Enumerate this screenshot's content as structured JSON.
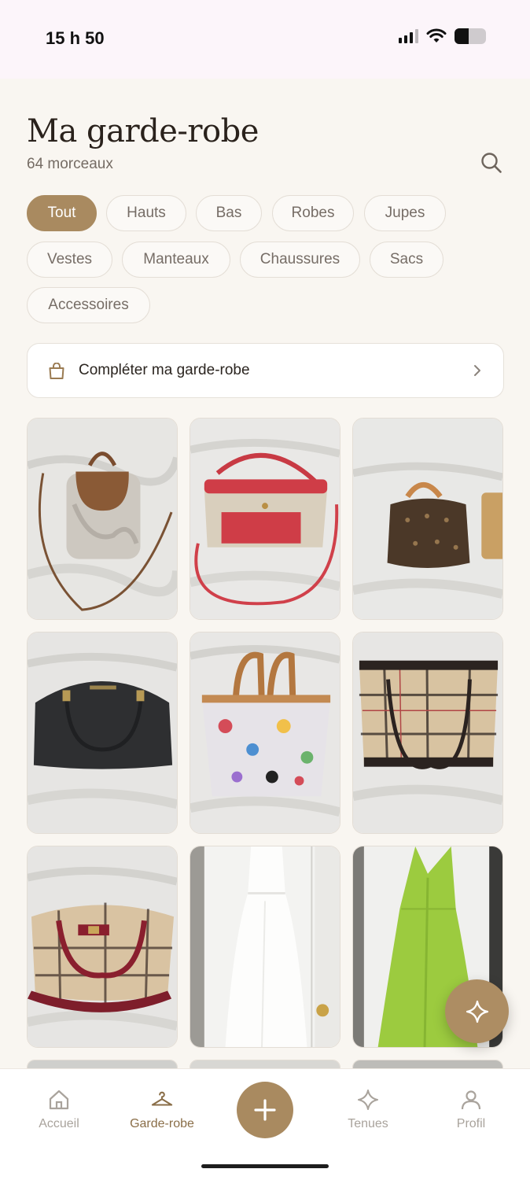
{
  "status_bar": {
    "time": "15 h 50",
    "battery_level": 0.45
  },
  "header": {
    "title": "Ma garde-robe",
    "count": "64 morceaux",
    "search_icon": "search-icon"
  },
  "filters": [
    {
      "label": "Tout",
      "active": true
    },
    {
      "label": "Hauts",
      "active": false
    },
    {
      "label": "Bas",
      "active": false
    },
    {
      "label": "Robes",
      "active": false
    },
    {
      "label": "Jupes",
      "active": false
    },
    {
      "label": "Vestes",
      "active": false
    },
    {
      "label": "Manteaux",
      "active": false
    },
    {
      "label": "Chaussures",
      "active": false
    },
    {
      "label": "Sacs",
      "active": false
    },
    {
      "label": "Accessoires",
      "active": false
    }
  ],
  "complete_card": {
    "label": "Compléter ma garde-robe",
    "icon": "shopping-bag-icon",
    "chevron": "chevron-right-icon"
  },
  "grid": {
    "items": [
      {
        "kind": "backpack-photo"
      },
      {
        "kind": "red-bucket-bag-photo"
      },
      {
        "kind": "monogram-speedy-photo"
      },
      {
        "kind": "black-satchel-photo"
      },
      {
        "kind": "cartoon-print-tote-photo"
      },
      {
        "kind": "plaid-handbag-photo"
      },
      {
        "kind": "plaid-burgundy-bag-photo"
      },
      {
        "kind": "white-dress-photo"
      },
      {
        "kind": "green-dress-photo"
      }
    ]
  },
  "fab": {
    "icon": "sparkle-icon"
  },
  "bottom_nav": {
    "items": [
      {
        "label": "Accueil",
        "icon": "home-icon",
        "active": false
      },
      {
        "label": "Garde-robe",
        "icon": "hanger-icon",
        "active": true
      },
      {
        "label": "Tenues",
        "icon": "sparkle-icon",
        "active": false
      },
      {
        "label": "Profil",
        "icon": "user-icon",
        "active": false
      }
    ],
    "add_icon": "plus-icon"
  },
  "colors": {
    "accent": "#a98a60",
    "background": "#f9f6f1",
    "chip_border": "#e4ded6",
    "nav_inactive": "#a9a39c"
  }
}
